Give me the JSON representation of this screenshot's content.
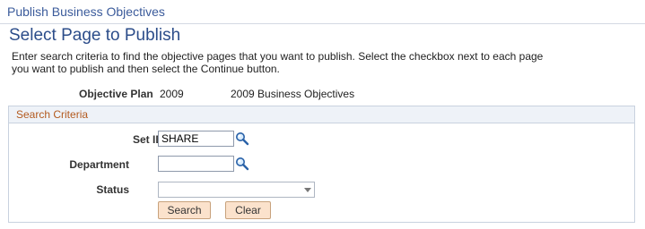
{
  "breadcrumb": "Publish Business Objectives",
  "page_title": "Select Page to Publish",
  "instructions": "Enter search criteria to find the objective pages that you want to publish. Select the checkbox next to each page you want to publish and then select the Continue button.",
  "objective_plan": {
    "label": "Objective Plan",
    "year": "2009",
    "description": "2009 Business Objectives"
  },
  "search_criteria": {
    "title": "Search Criteria",
    "setid": {
      "label": "Set ID",
      "value": "SHARE"
    },
    "department": {
      "label": "Department",
      "value": ""
    },
    "status": {
      "label": "Status",
      "selected": ""
    },
    "search_label": "Search",
    "clear_label": "Clear"
  },
  "icons": {
    "lookup": "magnifier-lookup-icon",
    "dropdown": "chevron-down-icon"
  },
  "colors": {
    "link_blue": "#3b5b9b",
    "section_title": "#b35a1f",
    "button_bg": "#fbe2cc"
  }
}
